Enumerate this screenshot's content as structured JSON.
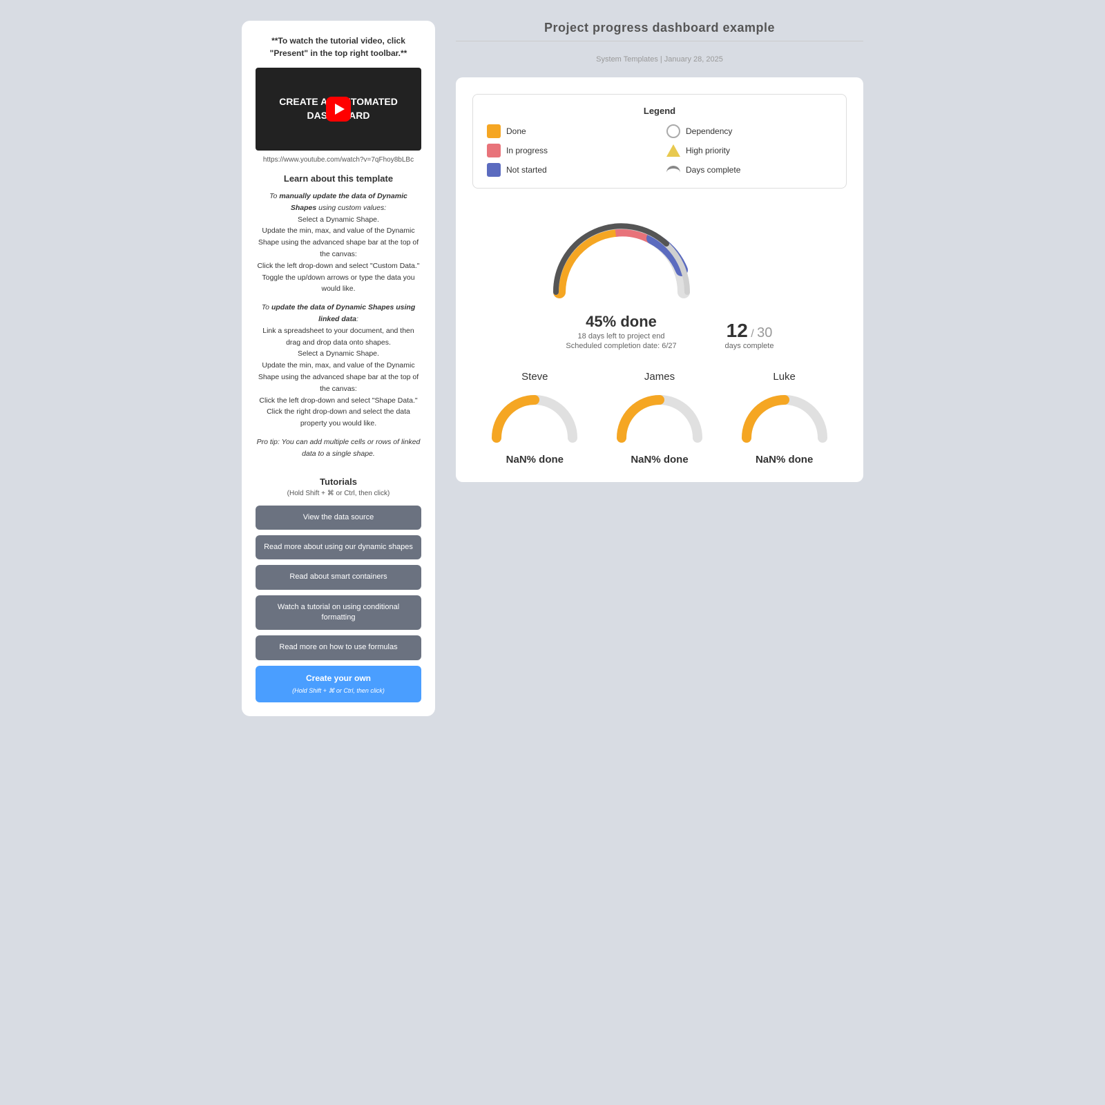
{
  "leftPanel": {
    "tutorialNote": "**To watch the tutorial video, click \"Present\" in the top right toolbar.**",
    "videoUrl": "https://www.youtube.com/watch?v=7qFhoy8bLBc",
    "videoTitle": "CREATE AN AUTOMATED DASHBOARD",
    "learnTitle": "Learn about this template",
    "instructions": [
      {
        "intro": "To manually update the data of Dynamic Shapes using custom values:",
        "steps": "Select a Dynamic Shape. Update the min, max, and value of the Dynamic Shape using the advanced shape bar at the top of the canvas: Click the left drop-down and select \"Custom Data.\" Toggle the up/down arrows or type the data you would like."
      },
      {
        "intro": "To update the data of Dynamic Shapes using linked data:",
        "steps": "Link a spreadsheet to your document, and then drag and drop data onto shapes. Select a Dynamic Shape. Update the min, max, and value of the Dynamic Shape using the advanced shape bar at the top of the canvas: Click the left drop-down and select \"Shape Data.\" Click the right drop-down and select the data property you would like."
      },
      {
        "protip": "Pro tip: You can add multiple cells or rows of linked data to a single shape."
      }
    ],
    "tutorials": {
      "title": "Tutorials",
      "subtitle": "(Hold Shift + ⌘ or Ctrl, then click)",
      "buttons": [
        "View the data source",
        "Read more about using our dynamic shapes",
        "Read about smart containers",
        "Watch a tutorial on using conditional formatting",
        "Read more on how to use formulas"
      ],
      "createButton": "Create your own",
      "createSub": "(Hold Shift + ⌘ or Ctrl, then click)"
    }
  },
  "dashboard": {
    "title": "Project progress dashboard example",
    "meta": "System Templates  |  January 28, 2025",
    "legend": {
      "title": "Legend",
      "items": [
        {
          "label": "Done",
          "type": "swatch-orange"
        },
        {
          "label": "Dependency",
          "type": "swatch-dep"
        },
        {
          "label": "In progress",
          "type": "swatch-pink"
        },
        {
          "label": "High priority",
          "type": "swatch-priority"
        },
        {
          "label": "Not started",
          "type": "swatch-blue"
        },
        {
          "label": "Days complete",
          "type": "swatch-days"
        }
      ]
    },
    "mainGauge": {
      "percent": 45,
      "label": "45% done",
      "sub1": "18 days left to project end",
      "sub2": "Scheduled completion date: 6/27",
      "daysComplete": 12,
      "daysTotal": 30,
      "daysLabel": "days complete"
    },
    "persons": [
      {
        "name": "Steve",
        "percent": "NaN"
      },
      {
        "name": "James",
        "percent": "NaN"
      },
      {
        "name": "Luke",
        "percent": "NaN"
      }
    ]
  }
}
